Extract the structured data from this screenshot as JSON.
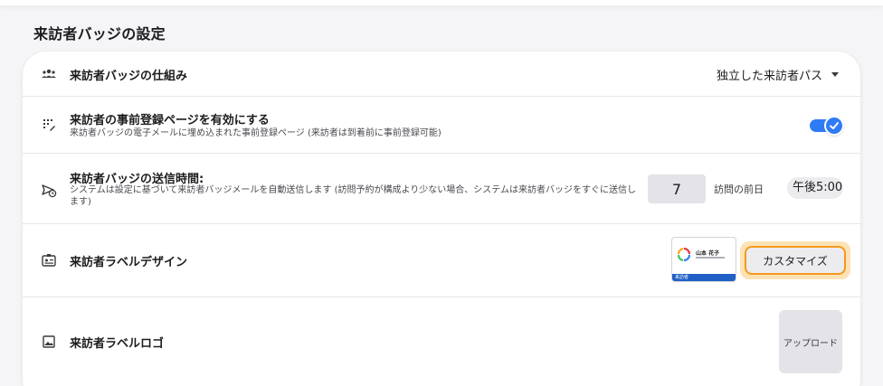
{
  "section": {
    "title": "来訪者バッジの設定"
  },
  "rows": {
    "mechanism": {
      "icon": "people-group-icon",
      "title": "来訪者バッジの仕組み",
      "dropdown_value": "独立した来訪者パス"
    },
    "preregistration": {
      "icon": "qr-sparkle-icon",
      "title": "来訪者の事前登録ページを有効にする",
      "description": "来訪者バッジの電子メールに埋め込まれた事前登録ページ (来訪者は到着前に事前登録可能)",
      "toggle_on": true
    },
    "send_time": {
      "icon": "send-clock-icon",
      "title": "来訪者バッジの送信時間:",
      "description": "システムは設定に基づいて来訪者バッジメールを自動送信します (訪問予約が構成より少ない場合、システムは来訪者バッジをすぐに送信します)",
      "days_value": "7",
      "days_suffix": "訪問の前日",
      "time_value": "午後5:00"
    },
    "label_design": {
      "icon": "id-badge-icon",
      "title": "来訪者ラベルデザイン",
      "preview_name": "山本 花子",
      "preview_footer": "来訪者",
      "customize_label": "カスタマイズ"
    },
    "label_logo": {
      "icon": "image-icon",
      "title": "来訪者ラベルロゴ",
      "upload_label": "アップロード"
    }
  },
  "colors": {
    "accent": "#2f7bf5",
    "focus_ring": "#f39a1c",
    "badge_bar": "#1f5fc6"
  }
}
